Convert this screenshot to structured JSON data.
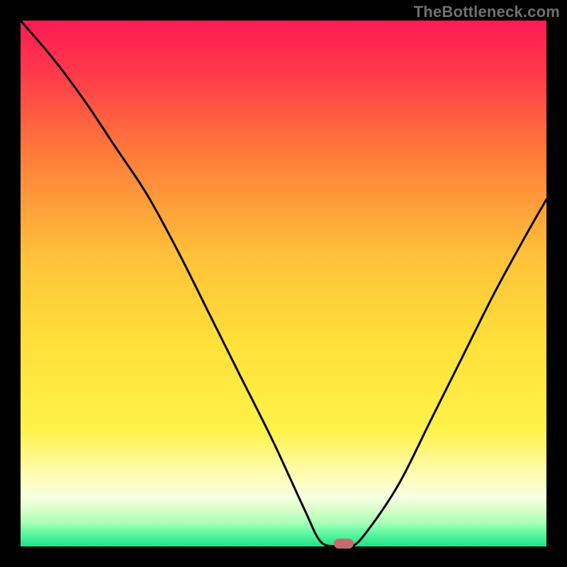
{
  "watermark": "TheBottleneck.com",
  "colors": {
    "frame": "#000000",
    "gradient_stops": [
      {
        "offset": 0.0,
        "color": "#ff1a55"
      },
      {
        "offset": 0.1,
        "color": "#ff3a4a"
      },
      {
        "offset": 0.25,
        "color": "#ff7a3a"
      },
      {
        "offset": 0.45,
        "color": "#ffc23a"
      },
      {
        "offset": 0.62,
        "color": "#ffe13a"
      },
      {
        "offset": 0.78,
        "color": "#fff24a"
      },
      {
        "offset": 0.86,
        "color": "#fffcb0"
      },
      {
        "offset": 0.905,
        "color": "#f7ffe0"
      },
      {
        "offset": 0.93,
        "color": "#d8ffc8"
      },
      {
        "offset": 0.955,
        "color": "#a8ffb8"
      },
      {
        "offset": 0.975,
        "color": "#5ef7a2"
      },
      {
        "offset": 1.0,
        "color": "#1ee28a"
      }
    ],
    "curve": "#000000",
    "marker": "#c76a6a"
  },
  "chart_data": {
    "type": "line",
    "title": "",
    "xlabel": "",
    "ylabel": "",
    "xlim": [
      0,
      100
    ],
    "ylim": [
      0,
      100
    ],
    "grid": false,
    "legend": false,
    "series": [
      {
        "name": "bottleneck-curve",
        "x": [
          0,
          6,
          12,
          18,
          24,
          30,
          36,
          42,
          48,
          54,
          57,
          60,
          63,
          66,
          72,
          78,
          84,
          90,
          96,
          100
        ],
        "y": [
          100,
          93,
          85,
          76,
          67,
          56,
          44,
          32,
          20,
          7,
          1,
          0,
          0,
          3,
          12,
          24,
          36,
          48,
          59,
          66
        ]
      }
    ],
    "marker": {
      "x": 61.5,
      "y": 0.5
    },
    "notes": "x is horizontal position as percent of plot width (0=left,100=right); y is bottleneck percentage (0 at bottom, 100 at top). Values read off the curve by visual estimation — chart has no axis ticks or numeric labels."
  }
}
